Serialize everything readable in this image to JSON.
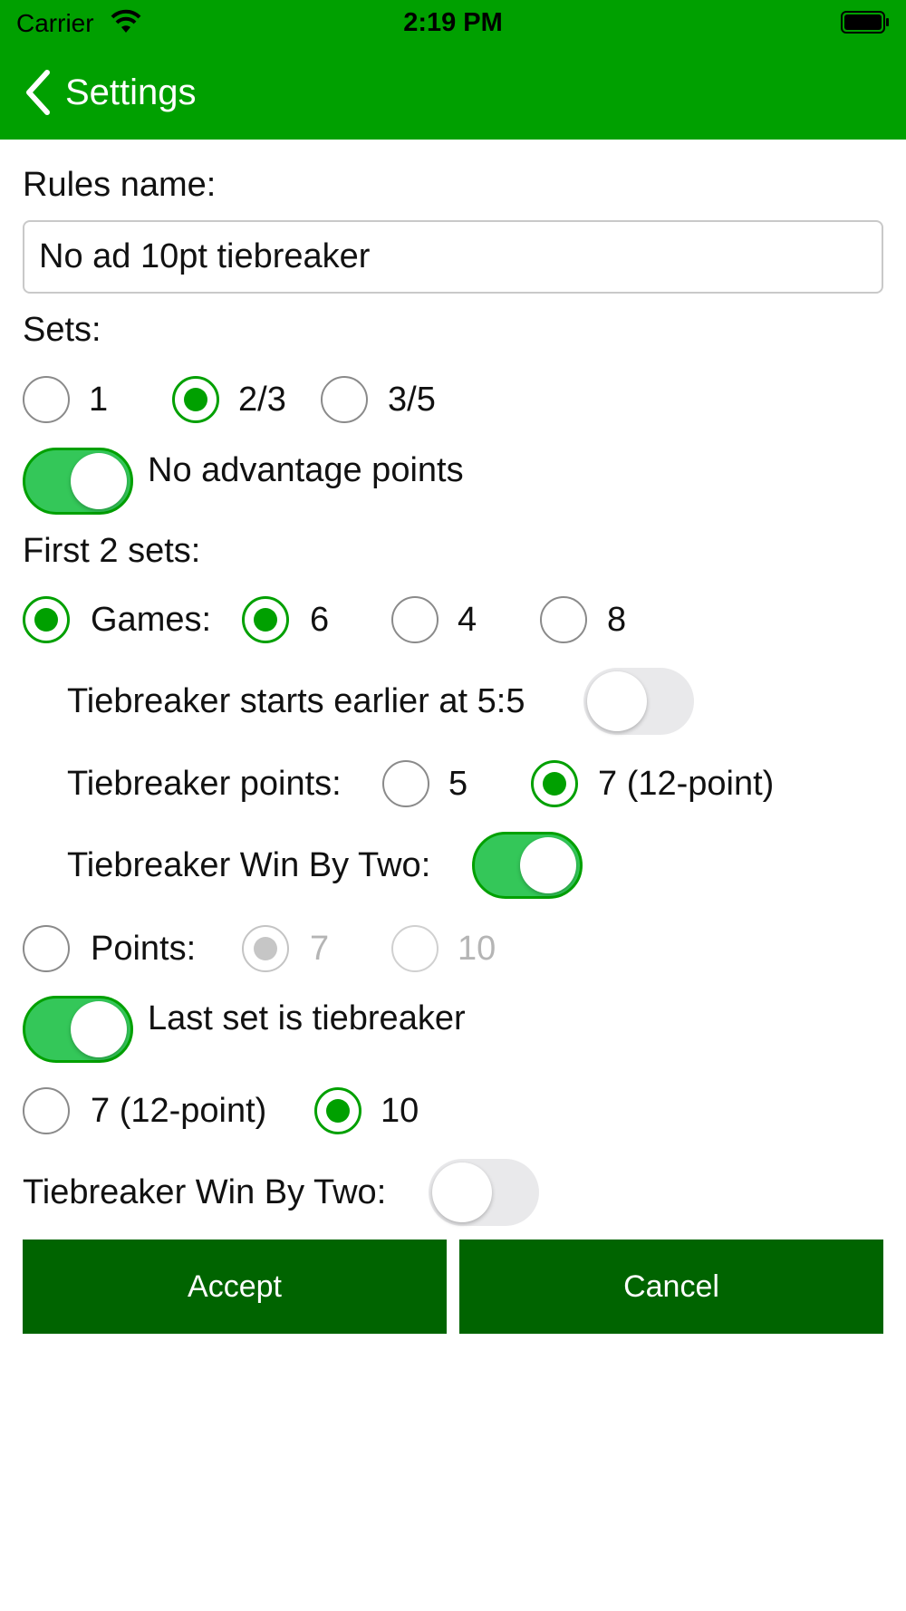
{
  "status_bar": {
    "carrier": "Carrier",
    "time": "2:19 PM"
  },
  "nav": {
    "back_label": "Settings"
  },
  "rules_name": {
    "label": "Rules name:",
    "value": "No ad 10pt tiebreaker"
  },
  "sets": {
    "label": "Sets:",
    "options": [
      "1",
      "2/3",
      "3/5"
    ],
    "selected": "2/3"
  },
  "no_advantage": {
    "label": "No advantage points",
    "on": true
  },
  "first_sets": {
    "label": "First 2 sets:",
    "games_label": "Games:",
    "games_options": [
      "6",
      "4",
      "8"
    ],
    "games_selected": "6",
    "earlier_label": "Tiebreaker starts earlier at 5:5",
    "earlier_on": false,
    "tb_points_label": "Tiebreaker points:",
    "tb_points_options": [
      "5",
      "7 (12-point)"
    ],
    "tb_points_selected": "7 (12-point)",
    "win_by_two_label": "Tiebreaker Win By Two:",
    "win_by_two_on": true,
    "points_label": "Points:",
    "points_options": [
      "7",
      "10"
    ]
  },
  "last_set": {
    "label": "Last set is tiebreaker",
    "on": true,
    "options": [
      "7 (12-point)",
      "10"
    ],
    "selected": "10",
    "win_by_two_label": "Tiebreaker Win By Two:",
    "win_by_two_on": false
  },
  "buttons": {
    "accept": "Accept",
    "cancel": "Cancel"
  },
  "colors": {
    "header": "#00a000",
    "accent": "#00a000",
    "toggle_on": "#34c759",
    "button": "#006400"
  }
}
